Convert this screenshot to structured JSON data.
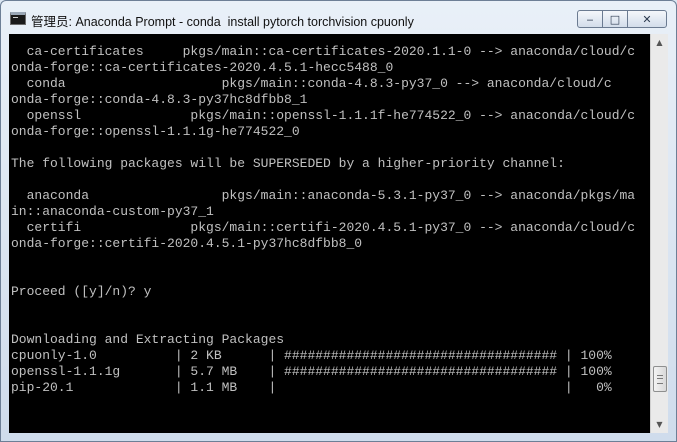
{
  "window": {
    "title": "管理员: Anaconda Prompt - conda  install pytorch torchvision cpuonly",
    "minimize_icon": "minimize-icon",
    "maximize_icon": "maximize-icon",
    "close_icon": "close-icon"
  },
  "console": {
    "lines": [
      "  ca-certificates     pkgs/main::ca-certificates-2020.1.1-0 --> anaconda/cloud/c",
      "onda-forge::ca-certificates-2020.4.5.1-hecc5488_0",
      "  conda                    pkgs/main::conda-4.8.3-py37_0 --> anaconda/cloud/c",
      "onda-forge::conda-4.8.3-py37hc8dfbb8_1",
      "  openssl              pkgs/main::openssl-1.1.1f-he774522_0 --> anaconda/cloud/c",
      "onda-forge::openssl-1.1.1g-he774522_0",
      "",
      "The following packages will be SUPERSEDED by a higher-priority channel:",
      "",
      "  anaconda                 pkgs/main::anaconda-5.3.1-py37_0 --> anaconda/pkgs/ma",
      "in::anaconda-custom-py37_1",
      "  certifi              pkgs/main::certifi-2020.4.5.1-py37_0 --> anaconda/cloud/c",
      "onda-forge::certifi-2020.4.5.1-py37hc8dfbb8_0",
      "",
      "",
      "Proceed ([y]/n)? y",
      "",
      "",
      "Downloading and Extracting Packages",
      "cpuonly-1.0          | 2 KB      | ################################### | 100%",
      "openssl-1.1.1g       | 5.7 MB    | ################################### | 100%",
      "pip-20.1             | 1.1 MB    |                                     |   0%"
    ]
  },
  "scrollbar": {
    "up_icon": "scroll-up-arrow-icon",
    "down_icon": "scroll-down-arrow-icon",
    "position": 0.93
  }
}
